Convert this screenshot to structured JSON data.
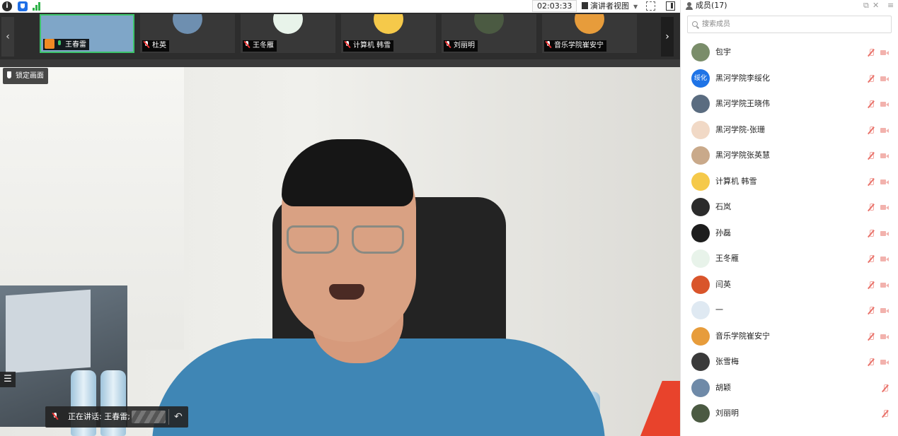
{
  "window": {
    "timer": "02:03:33",
    "view_mode": "演讲者视图"
  },
  "thumbnails": [
    {
      "name": "王春雷",
      "active": true,
      "mic": "on",
      "host": true,
      "avatar_color": "#7fa6c8"
    },
    {
      "name": "杜英",
      "active": false,
      "mic": "off",
      "host": false,
      "avatar_color": "#6e8fb0"
    },
    {
      "name": "王冬雁",
      "active": false,
      "mic": "off",
      "host": false,
      "avatar_color": "#e8f3ea"
    },
    {
      "name": "计算机 韩雪",
      "active": false,
      "mic": "off",
      "host": false,
      "avatar_color": "#f5c94a"
    },
    {
      "name": "刘丽明",
      "active": false,
      "mic": "off",
      "host": false,
      "avatar_color": "#4b5a42"
    },
    {
      "name": "音乐学院崔安宁",
      "active": false,
      "mic": "off",
      "host": false,
      "avatar_color": "#e79c3b"
    }
  ],
  "main_video": {
    "pin_label": "锁定画面",
    "speaking_label": "正在讲话: 王春雷;"
  },
  "members_panel": {
    "title": "成员(17)",
    "search_placeholder": "搜索成员",
    "members": [
      {
        "name": "包宇",
        "avatar_text": "",
        "avatar_color": "#7a8d6a",
        "mic_muted": true,
        "cam_off": true
      },
      {
        "name": "黑河学院李绥化",
        "avatar_text": "绥化",
        "avatar_color": "#1e73e6",
        "mic_muted": true,
        "cam_off": true
      },
      {
        "name": "黑河学院王晓伟",
        "avatar_text": "",
        "avatar_color": "#5a6c80",
        "mic_muted": true,
        "cam_off": true
      },
      {
        "name": "黑河学院-张珊",
        "avatar_text": "",
        "avatar_color": "#f1d9c6",
        "mic_muted": true,
        "cam_off": true
      },
      {
        "name": "黑河学院张英慧",
        "avatar_text": "",
        "avatar_color": "#c9a98a",
        "mic_muted": true,
        "cam_off": true
      },
      {
        "name": "计算机 韩雪",
        "avatar_text": "",
        "avatar_color": "#f5c94a",
        "mic_muted": true,
        "cam_off": true
      },
      {
        "name": "石岚",
        "avatar_text": "",
        "avatar_color": "#2b2b2b",
        "mic_muted": true,
        "cam_off": true
      },
      {
        "name": "孙磊",
        "avatar_text": "",
        "avatar_color": "#1d1d1d",
        "mic_muted": true,
        "cam_off": true
      },
      {
        "name": "王冬雁",
        "avatar_text": "",
        "avatar_color": "#e8f3ea",
        "mic_muted": true,
        "cam_off": true
      },
      {
        "name": "闫英",
        "avatar_text": "",
        "avatar_color": "#d9552b",
        "mic_muted": true,
        "cam_off": true
      },
      {
        "name": "一",
        "avatar_text": "",
        "avatar_color": "#dfe9f2",
        "mic_muted": true,
        "cam_off": true
      },
      {
        "name": "音乐学院崔安宁",
        "avatar_text": "",
        "avatar_color": "#e79c3b",
        "mic_muted": true,
        "cam_off": true
      },
      {
        "name": "张雪梅",
        "avatar_text": "",
        "avatar_color": "#3a3a3a",
        "mic_muted": true,
        "cam_off": true
      },
      {
        "name": "胡颖",
        "avatar_text": "",
        "avatar_color": "#6f8aa8",
        "mic_muted": true,
        "cam_off": false
      },
      {
        "name": "刘丽明",
        "avatar_text": "",
        "avatar_color": "#4b5a42",
        "mic_muted": true,
        "cam_off": false
      }
    ]
  },
  "colors": {
    "accent_green": "#3cc46a",
    "mute_red": "#e9736b",
    "host_orange": "#f08a24"
  }
}
